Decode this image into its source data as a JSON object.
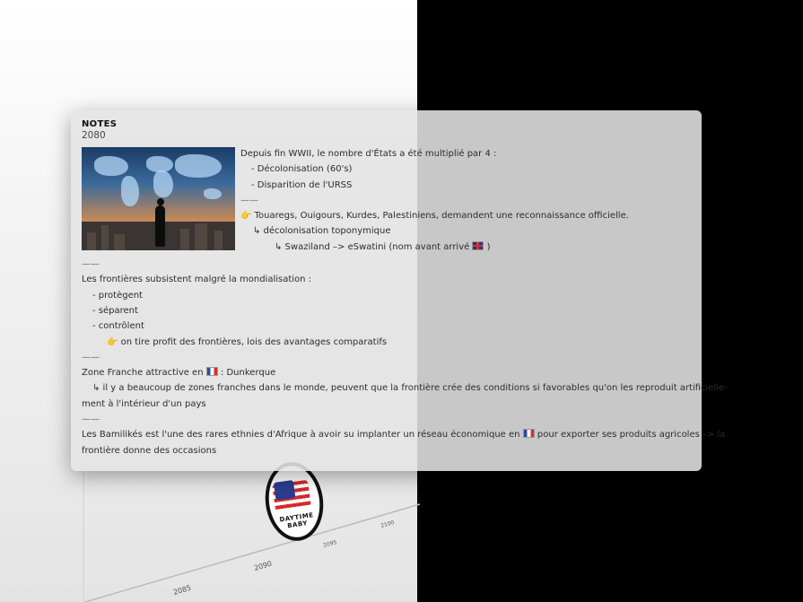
{
  "notes": {
    "title": "NOTES",
    "subtitle": "2080",
    "image_alt": "world-map-city-person",
    "top_lines": [
      "Depuis fin WWII, le nombre d'États a été multiplié par 4 :",
      "- Décolonisation (60's)",
      "- Disparition de l'URSS",
      "——",
      "Touaregs, Ouigours, Kurdes, Palestiniens, demandent une reconnaissance officielle.",
      "↳ décolonisation toponymique",
      "↳ Swaziland –> eSwatini (nom avant arrivé",
      ")"
    ],
    "body_lines": [
      "——",
      "Les frontières subsistent malgré la mondialisation :",
      "- protègent",
      "- séparent",
      "- contrôlent",
      "on tire profit des frontières, lois des avantages comparatifs",
      "——",
      "Zone Franche attractive en",
      ": Dunkerque",
      "↳ il y a beaucoup de zones franches dans le monde, peuvent que la frontière crée des conditions si favorables qu'on les reproduit artificielle-",
      "ment à l'intérieur d'un pays",
      "——",
      "Les Bamilikés est l'une des rares ethnies d'Afrique à avoir su implanter un réseau économique en",
      "pour exporter ses produits agricoles –> la",
      "frontière donne des occasions"
    ],
    "hand_emoji": "👉",
    "accent_hand": "#e6a51e"
  },
  "timeline": {
    "labels": [
      "2085",
      "2090",
      "2095",
      "2100"
    ],
    "badge_text": "DAYTIME BABY"
  }
}
